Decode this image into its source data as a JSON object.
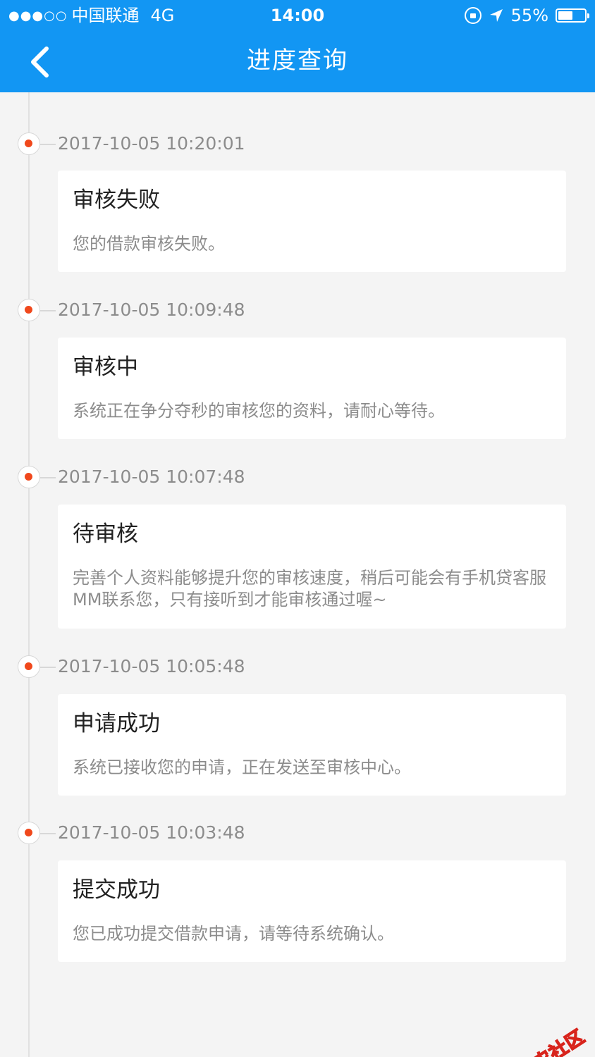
{
  "status_bar": {
    "signal": "●●●○○",
    "carrier": "中国联通",
    "network": "4G",
    "time": "14:00",
    "battery_percent_text": "55%",
    "battery_level": 0.55,
    "icons": [
      "orientation-lock-icon",
      "location-arrow-icon",
      "battery-icon"
    ]
  },
  "nav": {
    "title": "进度查询",
    "back_icon": "chevron-left-icon"
  },
  "timeline": [
    {
      "time": "2017-10-05 10:20:01",
      "title": "审核失败",
      "desc": "您的借款审核失败。"
    },
    {
      "time": "2017-10-05 10:09:48",
      "title": "审核中",
      "desc": "系统正在争分夺秒的审核您的资料，请耐心等待。"
    },
    {
      "time": "2017-10-05 10:07:48",
      "title": "待审核",
      "desc": "完善个人资料能够提升您的审核速度，稍后可能会有手机贷客服MM联系您，只有接听到才能审核通过喔~"
    },
    {
      "time": "2017-10-05 10:05:48",
      "title": "申请成功",
      "desc": "系统已接收您的申请，正在发送至审核中心。"
    },
    {
      "time": "2017-10-05 10:03:48",
      "title": "提交成功",
      "desc": "您已成功提交借款申请，请等待系统确认。"
    }
  ],
  "watermark": {
    "text": "卡农社区",
    "icon": "kanong-logo-icon"
  },
  "colors": {
    "header": "#1296f3",
    "page_background": "#f4f4f4",
    "marker_dot": "#f0481c",
    "secondary_text": "#8c8c8c",
    "watermark": "#d8241c"
  }
}
